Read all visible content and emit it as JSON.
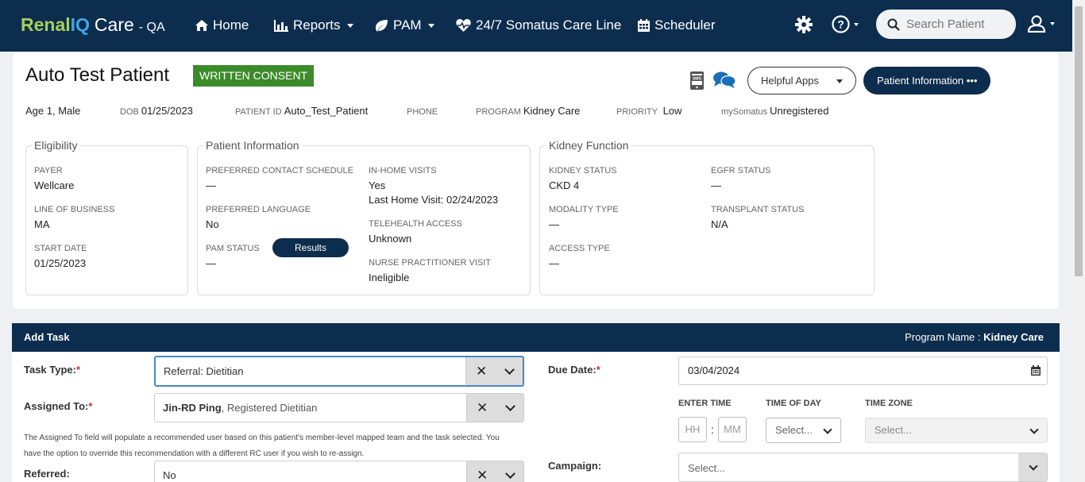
{
  "nav": {
    "brand_renal": "Renal",
    "brand_iq": "IQ",
    "brand_care": "Care",
    "brand_env": "- QA",
    "home": "Home",
    "reports": "Reports",
    "pam": "PAM",
    "care_line": "24/7 Somatus Care Line",
    "scheduler": "Scheduler",
    "search_placeholder": "Search Patient"
  },
  "patient": {
    "name": "Auto Test Patient",
    "consent": "WRITTEN CONSENT",
    "helpful_apps": "Helpful Apps",
    "patient_info_btn": "Patient Information •••",
    "age_sex": "Age 1, Male",
    "dob_label": "DOB",
    "dob": "01/25/2023",
    "patient_id_label": "PATIENT ID",
    "patient_id": "Auto_Test_Patient",
    "phone_label": "PHONE",
    "program_label": "PROGRAM",
    "program": "Kidney Care",
    "priority_label": "PRIORITY",
    "priority": "Low",
    "mysomatus_label": "mySomatus",
    "mysomatus": "Unregistered"
  },
  "eligibility": {
    "title": "Eligibility",
    "payer_label": "PAYER",
    "payer": "Wellcare",
    "lob_label": "LINE OF BUSINESS",
    "lob": "MA",
    "start_label": "START DATE",
    "start": "01/25/2023"
  },
  "patient_information": {
    "title": "Patient Information",
    "contact_label": "PREFERRED CONTACT SCHEDULE",
    "contact": "—",
    "language_label": "PREFERRED LANGUAGE",
    "language": "No",
    "pam_label": "PAM STATUS",
    "pam": "—",
    "results_btn": "Results",
    "inhome_label": "IN-HOME VISITS",
    "inhome": "Yes",
    "last_visit": "Last Home Visit: 02/24/2023",
    "telehealth_label": "TELEHEALTH ACCESS",
    "telehealth": "Unknown",
    "np_label": "NURSE PRACTITIONER VISIT",
    "np": "Ineligible"
  },
  "kidney": {
    "title": "Kidney Function",
    "status_label": "KIDNEY STATUS",
    "status": "CKD 4",
    "egfr_label": "EGFR STATUS",
    "egfr": "—",
    "modality_label": "MODALITY TYPE",
    "modality": "—",
    "transplant_label": "TRANSPLANT STATUS",
    "transplant": "N/A",
    "access_label": "ACCESS TYPE",
    "access": "—"
  },
  "task": {
    "title": "Add Task",
    "program_label": "Program Name :",
    "program": "Kidney Care",
    "type_label": "Task Type:",
    "type_value": "Referral: Dietitian",
    "assigned_label": "Assigned To:",
    "assigned_name": "Jin-RD Ping",
    "assigned_role": ", Registered Dietitian",
    "note": "The Assigned To field will populate a recommended user based on this patient's member-level mapped team and the task selected. You have the option to override this recommendation with a different RC user if you wish to re-assign.",
    "referred_label": "Referred:",
    "referred_value": "No",
    "due_label": "Due Date:",
    "due_value": "03/04/2024",
    "enter_time_label": "ENTER TIME",
    "hh": "HH",
    "mm": "MM",
    "tod_label": "TIME OF DAY",
    "tod_value": "Select...",
    "tz_label": "TIME ZONE",
    "tz_value": "Select...",
    "campaign_label": "Campaign:",
    "campaign_value": "Select..."
  }
}
